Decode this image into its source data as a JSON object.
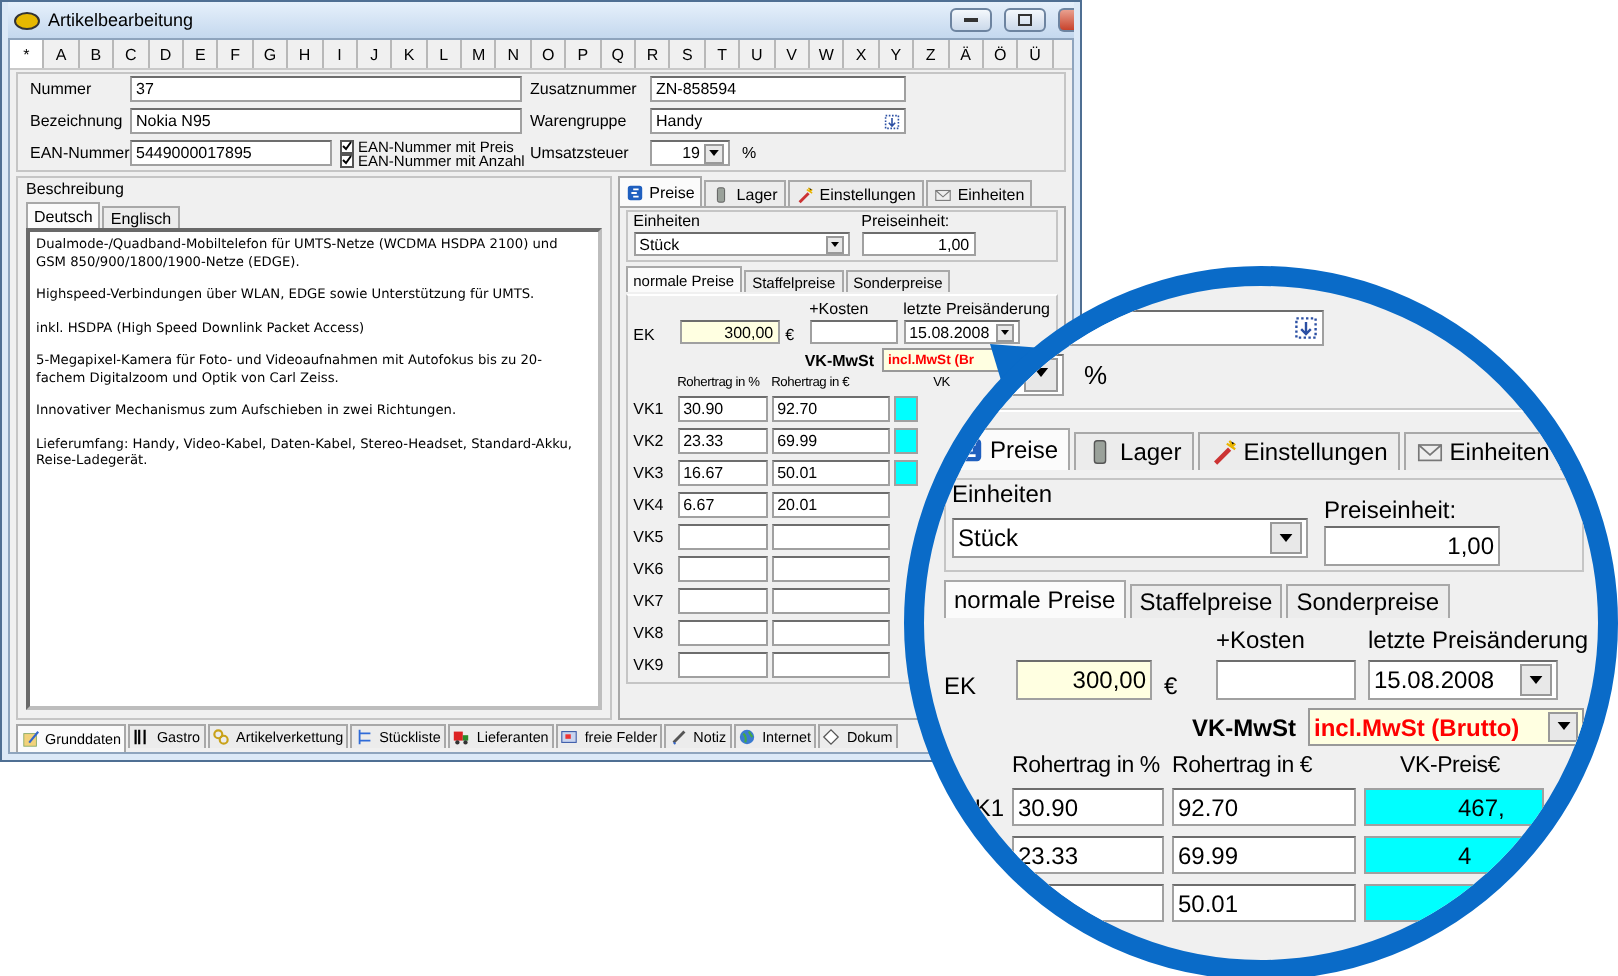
{
  "window": {
    "title": "Artikelbearbeitung"
  },
  "alphabet": [
    {
      "label": "*",
      "selected": true
    },
    {
      "label": "A",
      "selected": false
    },
    {
      "label": "B",
      "selected": false
    },
    {
      "label": "C",
      "selected": false
    },
    {
      "label": "D",
      "selected": false
    },
    {
      "label": "E",
      "selected": false
    },
    {
      "label": "F",
      "selected": false
    },
    {
      "label": "G",
      "selected": false
    },
    {
      "label": "H",
      "selected": false
    },
    {
      "label": "I",
      "selected": false
    },
    {
      "label": "J",
      "selected": false
    },
    {
      "label": "K",
      "selected": false
    },
    {
      "label": "L",
      "selected": false
    },
    {
      "label": "M",
      "selected": false
    },
    {
      "label": "N",
      "selected": false
    },
    {
      "label": "O",
      "selected": false
    },
    {
      "label": "P",
      "selected": false
    },
    {
      "label": "Q",
      "selected": false
    },
    {
      "label": "R",
      "selected": false
    },
    {
      "label": "S",
      "selected": false
    },
    {
      "label": "T",
      "selected": false
    },
    {
      "label": "U",
      "selected": false
    },
    {
      "label": "V",
      "selected": false
    },
    {
      "label": "W",
      "selected": false
    },
    {
      "label": "X",
      "selected": false
    },
    {
      "label": "Y",
      "selected": false
    },
    {
      "label": "Z",
      "selected": false
    },
    {
      "label": "Ä",
      "selected": false
    },
    {
      "label": "Ö",
      "selected": false
    },
    {
      "label": "Ü",
      "selected": false
    }
  ],
  "header": {
    "nummer": {
      "label": "Nummer",
      "value": "37"
    },
    "zusatznummer": {
      "label": "Zusatznummer",
      "value": "ZN-858594"
    },
    "bezeichnung": {
      "label": "Bezeichnung",
      "value": "Nokia N95"
    },
    "warengruppe": {
      "label": "Warengruppe",
      "value": "Handy"
    },
    "ean": {
      "label": "EAN-Nummer",
      "value": "5449000017895"
    },
    "ean_options": [
      {
        "label": "EAN-Nummer mit Preis",
        "checked": true
      },
      {
        "label": "EAN-Nummer mit Anzahl",
        "checked": true
      }
    ],
    "umsatzsteuer": {
      "label": "Umsatzsteuer",
      "value": "19",
      "unit": "%"
    }
  },
  "description": {
    "label": "Beschreibung",
    "tabs": [
      {
        "label": "Deutsch",
        "selected": true
      },
      {
        "label": "Englisch",
        "selected": false
      }
    ],
    "paragraphs": [
      "Dualmode-/Quadband-Mobiltelefon für UMTS-Netze (WCDMA HSDPA 2100) und GSM 850/900/1800/1900-Netze (EDGE).",
      "Highspeed-Verbindungen über WLAN, EDGE sowie Unterstützung für UMTS.",
      "inkl. HSDPA (High Speed Downlink Packet Access)",
      "5-Megapixel-Kamera für Foto- und Videoaufnahmen mit Autofokus bis zu 20-fachem Digitalzoom und Optik von Carl Zeiss.",
      "Innovativer Mechanismus zum Aufschieben in zwei Richtungen.",
      "Lieferumfang: Handy, Video-Kabel, Daten-Kabel, Stereo-Headset, Standard-Akku, Reise-Ladegerät."
    ]
  },
  "prices": {
    "tabs": [
      {
        "label": "Preise",
        "selected": true,
        "kind": "euro"
      },
      {
        "label": "Lager",
        "selected": false,
        "kind": "bin"
      },
      {
        "label": "Einstellungen",
        "selected": false,
        "kind": "wand"
      },
      {
        "label": "Einheiten",
        "selected": false,
        "kind": "mail"
      }
    ],
    "einheiten": {
      "label": "Einheiten",
      "value": "Stück"
    },
    "preiseinheit": {
      "label": "Preiseinheit:",
      "value": "1,00"
    },
    "price_tabs": [
      {
        "label": "normale Preise",
        "selected": true
      },
      {
        "label": "Staffelpreise",
        "selected": false
      },
      {
        "label": "Sonderpreise",
        "selected": false
      }
    ],
    "ek": {
      "label": "EK",
      "value": "300,00",
      "currency": "€"
    },
    "kosten": {
      "label": "+Kosten"
    },
    "preisaenderung": {
      "label": "letzte Preisänderung",
      "value": "15.08.2008"
    },
    "vk_mwst": {
      "label": "VK-MwSt",
      "value": "incl.MwSt (Br"
    },
    "columns": [
      "Rohertrag in %",
      "Rohertrag in €",
      "VK"
    ],
    "rows": [
      {
        "label": "VK1",
        "percent": "30.90",
        "amount": "92.70",
        "priced": true
      },
      {
        "label": "VK2",
        "percent": "23.33",
        "amount": "69.99",
        "priced": true
      },
      {
        "label": "VK3",
        "percent": "16.67",
        "amount": "50.01",
        "priced": true
      },
      {
        "label": "VK4",
        "percent": "6.67",
        "amount": "20.01",
        "priced": false
      },
      {
        "label": "VK5",
        "priced": false
      },
      {
        "label": "VK6",
        "priced": false
      },
      {
        "label": "VK7",
        "priced": false
      },
      {
        "label": "VK8",
        "priced": false
      },
      {
        "label": "VK9",
        "priced": false
      }
    ]
  },
  "bottom_tabs": [
    {
      "label": "Grunddaten",
      "selected": true,
      "kind": "notepad"
    },
    {
      "label": "Gastro",
      "selected": false,
      "kind": "cutlery"
    },
    {
      "label": "Artikelverkettung",
      "selected": false,
      "kind": "chain"
    },
    {
      "label": "Stückliste",
      "selected": false,
      "kind": "tree"
    },
    {
      "label": "Lieferanten",
      "selected": false,
      "kind": "truck"
    },
    {
      "label": "freie Felder",
      "selected": false,
      "kind": "grid"
    },
    {
      "label": "Notiz",
      "selected": false,
      "kind": "pen"
    },
    {
      "label": "Internet",
      "selected": false,
      "kind": "globe"
    },
    {
      "label": "Dokum",
      "selected": false,
      "kind": "doc"
    }
  ],
  "magnifier": {
    "unit": "%",
    "tabs": [
      {
        "label": "Preise",
        "selected": true,
        "kind": "euro"
      },
      {
        "label": "Lager",
        "selected": false,
        "kind": "bin"
      },
      {
        "label": "Einstellungen",
        "selected": false,
        "kind": "wand"
      },
      {
        "label": "Einheiten",
        "selected": false,
        "kind": "mail"
      }
    ],
    "einheiten": {
      "label": "Einheiten",
      "value": "Stück"
    },
    "preiseinheit": {
      "label": "Preiseinheit:",
      "value": "1,00"
    },
    "price_tabs": [
      {
        "label": "normale Preise",
        "selected": true
      },
      {
        "label": "Staffelpreise",
        "selected": false
      },
      {
        "label": "Sonderpreise",
        "selected": false
      }
    ],
    "ek": {
      "label": "EK",
      "value": "300,00",
      "currency": "€"
    },
    "kosten": {
      "label": "+Kosten"
    },
    "preisaenderung": {
      "label": "letzte Preisänderung",
      "value": "15.08.2008"
    },
    "vk_mwst": {
      "label": "VK-MwSt",
      "value": "incl.MwSt (Brutto)"
    },
    "columns": [
      "Rohertrag in %",
      "Rohertrag in €",
      "VK-Preis€"
    ],
    "rows": [
      {
        "label": "K1",
        "percent": "30.90",
        "amount": "92.70",
        "price": "467,"
      },
      {
        "percent": "23.33",
        "amount": "69.99",
        "price": "4"
      },
      {
        "amount": "50.01"
      }
    ]
  }
}
